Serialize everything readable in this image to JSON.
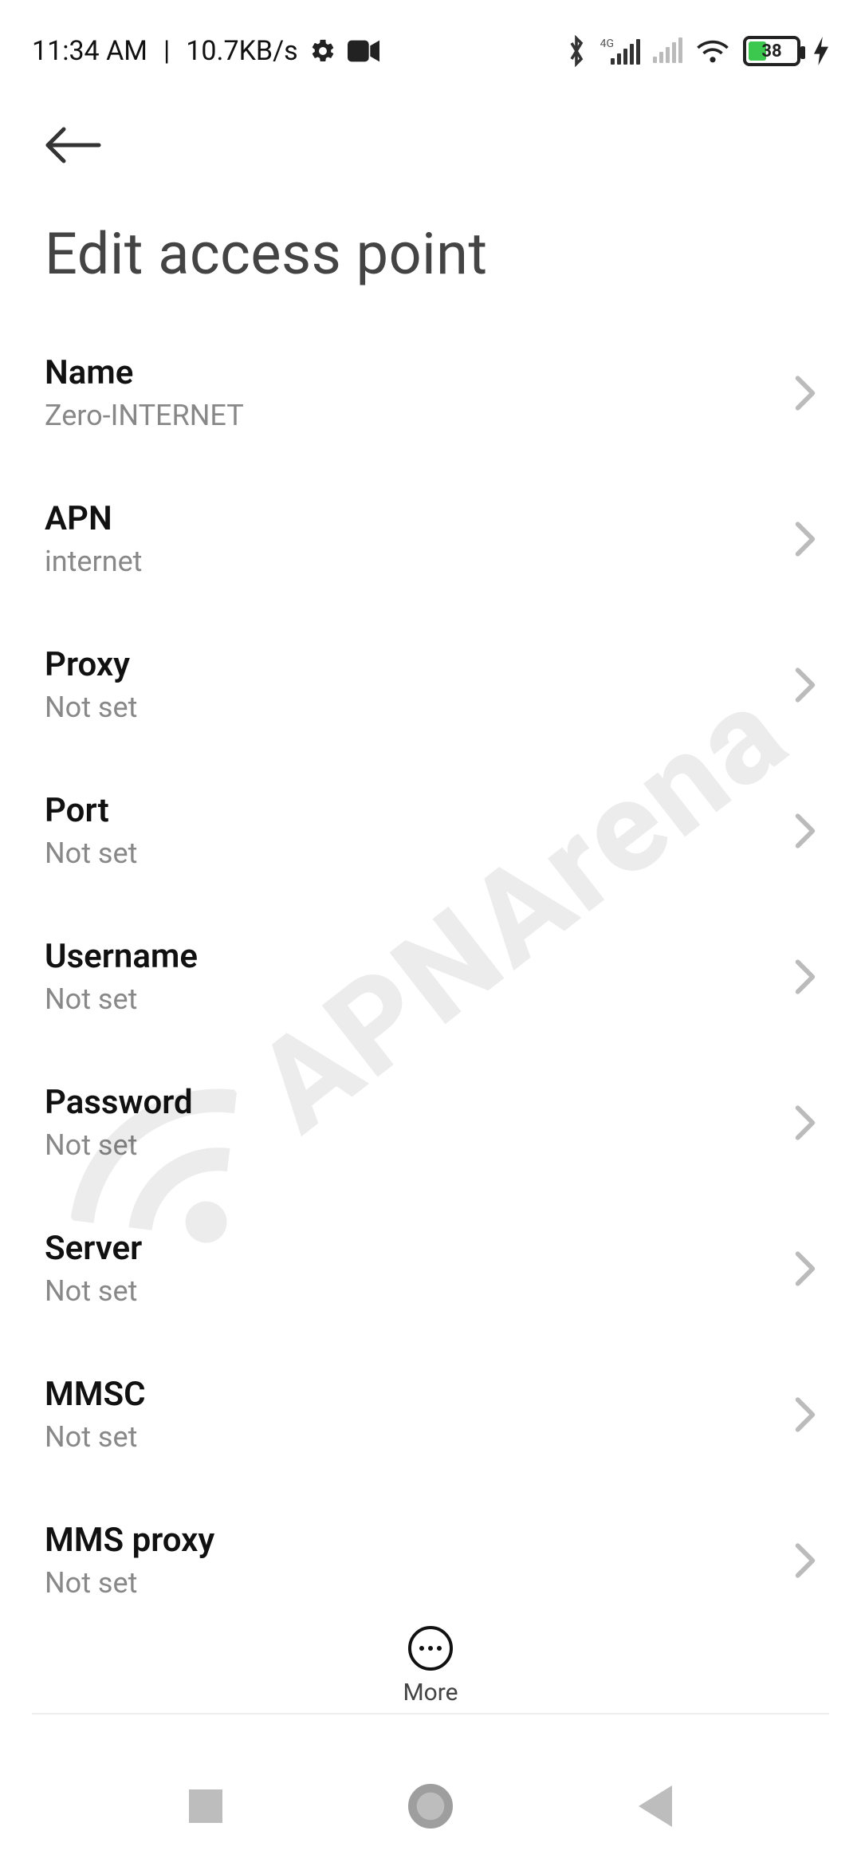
{
  "status": {
    "time": "11:34 AM",
    "speed": "10.7KB/s",
    "network_type": "4G",
    "battery_percent": "38"
  },
  "header": {
    "title": "Edit access point"
  },
  "fields": [
    {
      "label": "Name",
      "value": "Zero-INTERNET"
    },
    {
      "label": "APN",
      "value": "internet"
    },
    {
      "label": "Proxy",
      "value": "Not set"
    },
    {
      "label": "Port",
      "value": "Not set"
    },
    {
      "label": "Username",
      "value": "Not set"
    },
    {
      "label": "Password",
      "value": "Not set"
    },
    {
      "label": "Server",
      "value": "Not set"
    },
    {
      "label": "MMSC",
      "value": "Not set"
    },
    {
      "label": "MMS proxy",
      "value": "Not set"
    }
  ],
  "bottom": {
    "more_label": "More"
  },
  "watermark": {
    "text": "APNArena"
  }
}
